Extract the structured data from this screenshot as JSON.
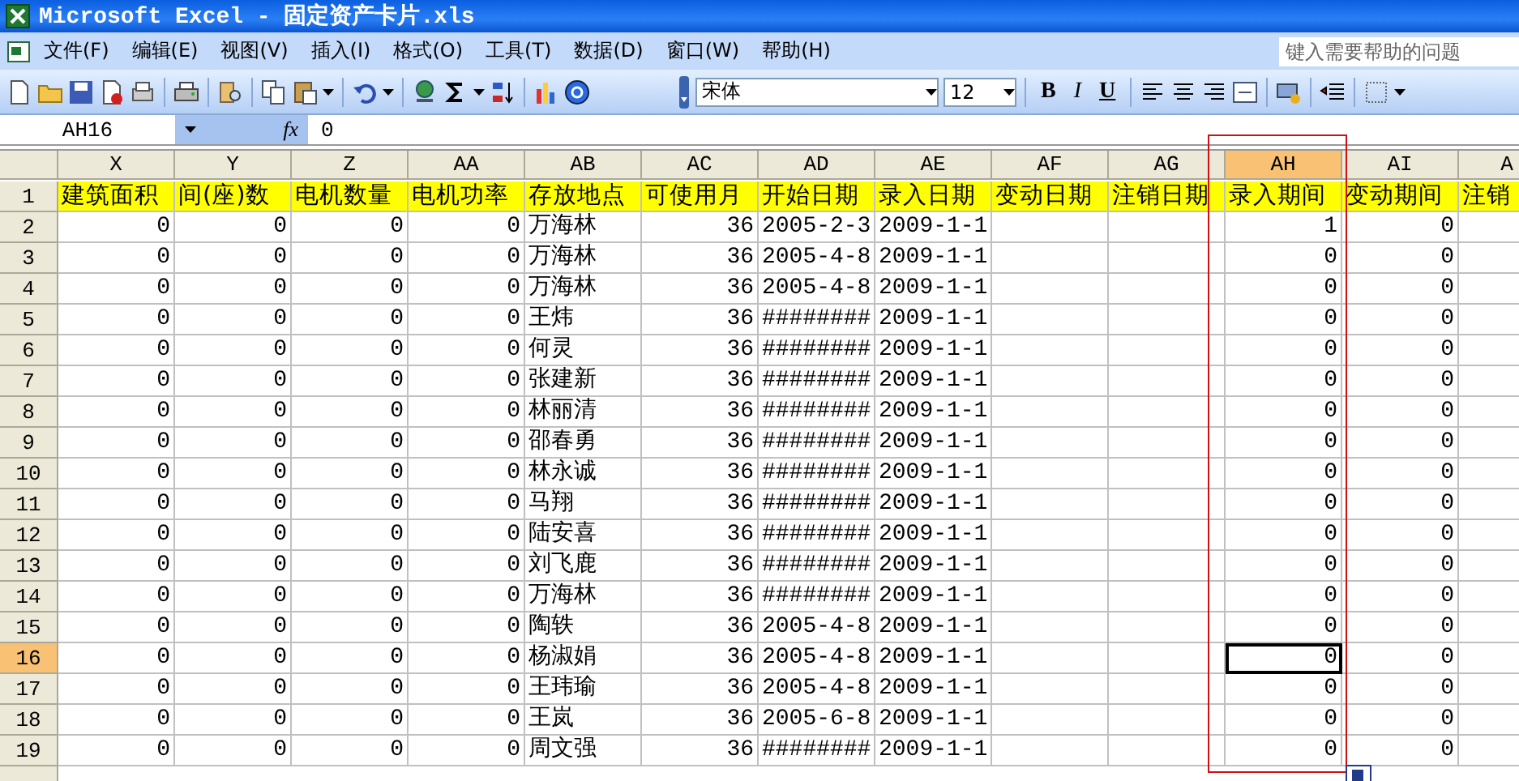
{
  "window": {
    "title": "Microsoft Excel - 固定资产卡片.xls"
  },
  "menu": [
    "文件(F)",
    "编辑(E)",
    "视图(V)",
    "插入(I)",
    "格式(O)",
    "工具(T)",
    "数据(D)",
    "窗口(W)",
    "帮助(H)"
  ],
  "help_box": {
    "placeholder": "键入需要帮助的问题"
  },
  "format_toolbar": {
    "font": "宋体",
    "size": "12",
    "bold": "B",
    "italic": "I",
    "underline": "U"
  },
  "formula_bar": {
    "name_box": "AH16",
    "fx_label": "fx",
    "value": "0"
  },
  "columns": [
    {
      "label": "X",
      "kind": "number",
      "selected": false
    },
    {
      "label": "Y",
      "kind": "number",
      "selected": false
    },
    {
      "label": "Z",
      "kind": "number",
      "selected": false
    },
    {
      "label": "AA",
      "kind": "number",
      "selected": false
    },
    {
      "label": "AB",
      "kind": "text",
      "selected": false
    },
    {
      "label": "AC",
      "kind": "number",
      "selected": false
    },
    {
      "label": "AD",
      "kind": "number",
      "selected": false
    },
    {
      "label": "AE",
      "kind": "number",
      "selected": false
    },
    {
      "label": "AF",
      "kind": "number",
      "selected": false
    },
    {
      "label": "AG",
      "kind": "number",
      "selected": false
    },
    {
      "label": "AH",
      "kind": "number",
      "selected": true
    },
    {
      "label": "AI",
      "kind": "number",
      "selected": false
    },
    {
      "label": "A",
      "kind": "number",
      "selected": false
    }
  ],
  "rows": [
    {
      "header": "1",
      "kind": "heading",
      "selected": false,
      "cells": [
        "建筑面积",
        "间(座)数",
        "电机数量",
        "电机功率",
        "存放地点",
        "可使用月",
        "开始日期",
        "录入日期",
        "变动日期",
        "注销日期",
        "录入期间",
        "变动期间",
        "注销"
      ]
    },
    {
      "header": "2",
      "kind": "data",
      "selected": false,
      "cells": [
        "0",
        "0",
        "0",
        "0",
        "万海林",
        "36",
        "2005-2-3",
        "2009-1-1",
        null,
        null,
        "1",
        "0",
        null
      ]
    },
    {
      "header": "3",
      "kind": "data",
      "selected": false,
      "cells": [
        "0",
        "0",
        "0",
        "0",
        "万海林",
        "36",
        "2005-4-8",
        "2009-1-1",
        null,
        null,
        "0",
        "0",
        null
      ]
    },
    {
      "header": "4",
      "kind": "data",
      "selected": false,
      "cells": [
        "0",
        "0",
        "0",
        "0",
        "万海林",
        "36",
        "2005-4-8",
        "2009-1-1",
        null,
        null,
        "0",
        "0",
        null
      ]
    },
    {
      "header": "5",
      "kind": "data",
      "selected": false,
      "cells": [
        "0",
        "0",
        "0",
        "0",
        "王炜",
        "36",
        "########",
        "2009-1-1",
        null,
        null,
        "0",
        "0",
        null
      ]
    },
    {
      "header": "6",
      "kind": "data",
      "selected": false,
      "cells": [
        "0",
        "0",
        "0",
        "0",
        "何灵",
        "36",
        "########",
        "2009-1-1",
        null,
        null,
        "0",
        "0",
        null
      ]
    },
    {
      "header": "7",
      "kind": "data",
      "selected": false,
      "cells": [
        "0",
        "0",
        "0",
        "0",
        "张建新",
        "36",
        "########",
        "2009-1-1",
        null,
        null,
        "0",
        "0",
        null
      ]
    },
    {
      "header": "8",
      "kind": "data",
      "selected": false,
      "cells": [
        "0",
        "0",
        "0",
        "0",
        "林丽清",
        "36",
        "########",
        "2009-1-1",
        null,
        null,
        "0",
        "0",
        null
      ]
    },
    {
      "header": "9",
      "kind": "data",
      "selected": false,
      "cells": [
        "0",
        "0",
        "0",
        "0",
        "邵春勇",
        "36",
        "########",
        "2009-1-1",
        null,
        null,
        "0",
        "0",
        null
      ]
    },
    {
      "header": "10",
      "kind": "data",
      "selected": false,
      "cells": [
        "0",
        "0",
        "0",
        "0",
        "林永诚",
        "36",
        "########",
        "2009-1-1",
        null,
        null,
        "0",
        "0",
        null
      ]
    },
    {
      "header": "11",
      "kind": "data",
      "selected": false,
      "cells": [
        "0",
        "0",
        "0",
        "0",
        "马翔",
        "36",
        "########",
        "2009-1-1",
        null,
        null,
        "0",
        "0",
        null
      ]
    },
    {
      "header": "12",
      "kind": "data",
      "selected": false,
      "cells": [
        "0",
        "0",
        "0",
        "0",
        "陆安喜",
        "36",
        "########",
        "2009-1-1",
        null,
        null,
        "0",
        "0",
        null
      ]
    },
    {
      "header": "13",
      "kind": "data",
      "selected": false,
      "cells": [
        "0",
        "0",
        "0",
        "0",
        "刘飞鹿",
        "36",
        "########",
        "2009-1-1",
        null,
        null,
        "0",
        "0",
        null
      ]
    },
    {
      "header": "14",
      "kind": "data",
      "selected": false,
      "cells": [
        "0",
        "0",
        "0",
        "0",
        "万海林",
        "36",
        "########",
        "2009-1-1",
        null,
        null,
        "0",
        "0",
        null
      ]
    },
    {
      "header": "15",
      "kind": "data",
      "selected": false,
      "cells": [
        "0",
        "0",
        "0",
        "0",
        "陶轶",
        "36",
        "2005-4-8",
        "2009-1-1",
        null,
        null,
        "0",
        "0",
        null
      ]
    },
    {
      "header": "16",
      "kind": "data",
      "selected": true,
      "cells": [
        "0",
        "0",
        "0",
        "0",
        "杨淑娟",
        "36",
        "2005-4-8",
        "2009-1-1",
        null,
        null,
        "0",
        "0",
        null
      ]
    },
    {
      "header": "17",
      "kind": "data",
      "selected": false,
      "cells": [
        "0",
        "0",
        "0",
        "0",
        "王玮瑜",
        "36",
        "2005-4-8",
        "2009-1-1",
        null,
        null,
        "0",
        "0",
        null
      ]
    },
    {
      "header": "18",
      "kind": "data",
      "selected": false,
      "cells": [
        "0",
        "0",
        "0",
        "0",
        "王岚",
        "36",
        "2005-6-8",
        "2009-1-1",
        null,
        null,
        "0",
        "0",
        null
      ]
    },
    {
      "header": "19",
      "kind": "data",
      "selected": false,
      "cells": [
        "0",
        "0",
        "0",
        "0",
        "周文强",
        "36",
        "########",
        "2009-1-1",
        null,
        null,
        "0",
        "0",
        null
      ]
    }
  ]
}
